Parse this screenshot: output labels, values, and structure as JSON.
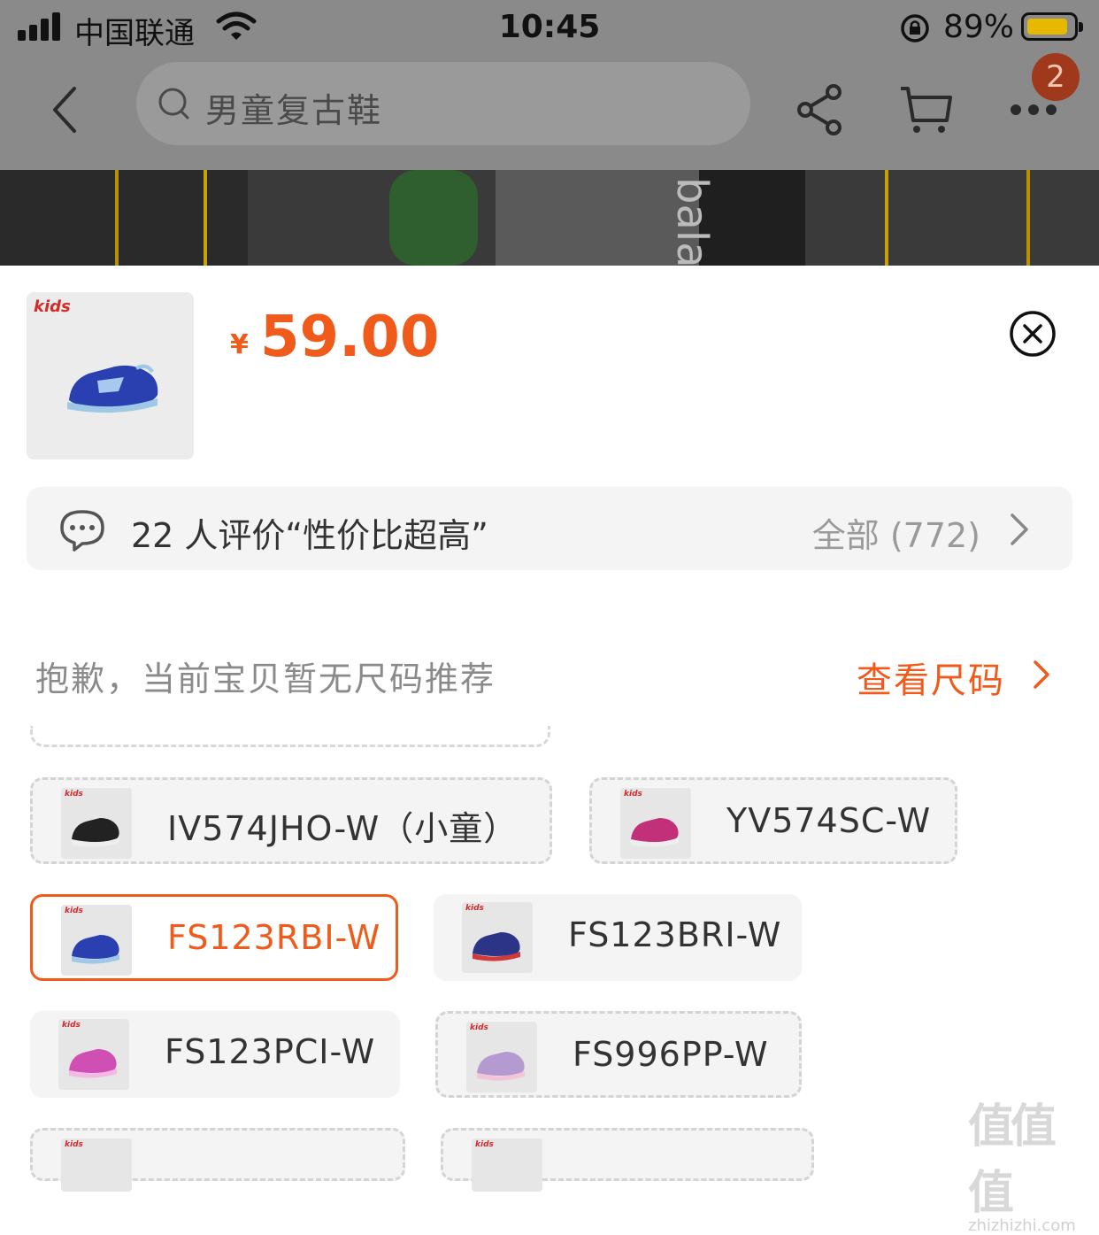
{
  "status_bar": {
    "carrier": "中国联通",
    "time": "10:45",
    "battery_percent": "89%",
    "battery_level": 0.89,
    "battery_color": "#e6b800"
  },
  "nav": {
    "search_placeholder": "男童复古鞋",
    "badge_count": "2",
    "icons": [
      "back-icon",
      "search-icon",
      "share-icon",
      "cart-icon",
      "more-icon"
    ]
  },
  "banner": {
    "brand_text": "balanc"
  },
  "product": {
    "brand_logo": "kids",
    "currency": "¥",
    "price": "59.00",
    "price_color": "#f05a1a"
  },
  "review": {
    "summary": "22 人评价“性价比超高”",
    "all_label": "全部 (772)"
  },
  "size": {
    "note": "抱歉，当前宝贝暂无尺码推荐",
    "link_label": "查看尺码"
  },
  "skus": [
    {
      "label": "IV574JHO-W（小童）",
      "style": "dashed",
      "shoe_color": "#222222"
    },
    {
      "label": "YV574SC-W",
      "style": "dashed",
      "shoe_color": "#c2307a"
    },
    {
      "label": "FS123RBI-W",
      "style": "selected",
      "shoe_color": "#2a3fb0"
    },
    {
      "label": "FS123BRI-W",
      "style": "normal",
      "shoe_color": "#2c3488"
    },
    {
      "label": "FS123PCI-W",
      "style": "normal",
      "shoe_color": "#d04fb4"
    },
    {
      "label": "FS996PP-W",
      "style": "dashed",
      "shoe_color": "#b49ad0"
    }
  ],
  "watermark": {
    "chars": "值值值",
    "url": "zhizhizhi.com"
  }
}
